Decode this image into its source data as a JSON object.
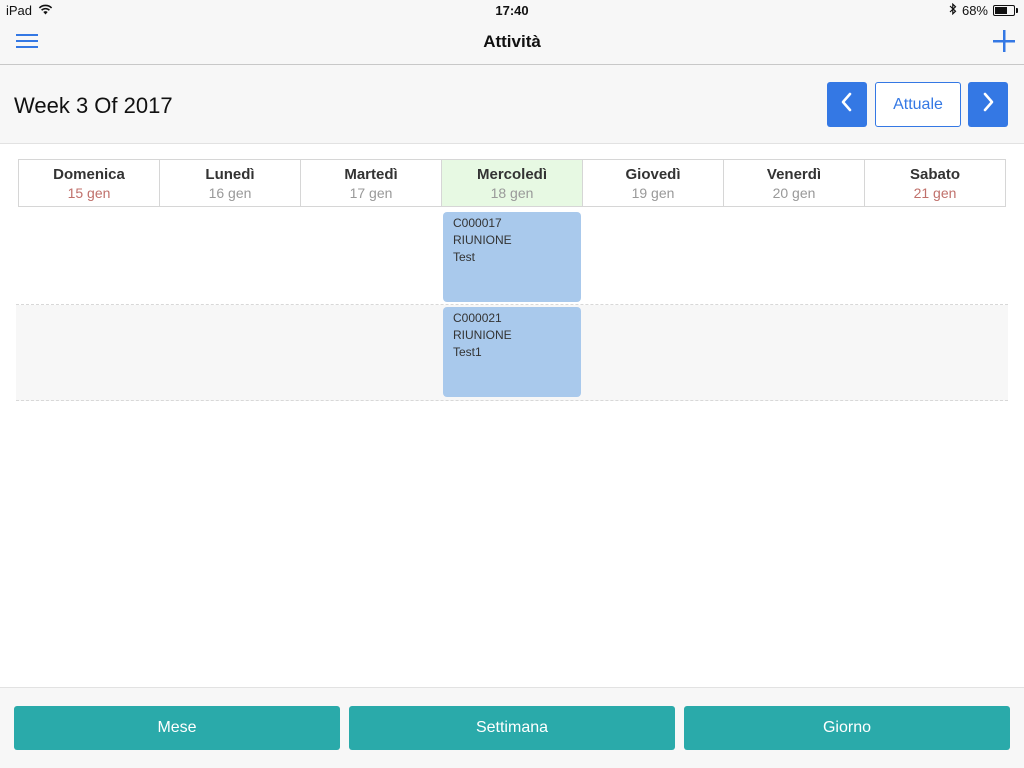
{
  "status_bar": {
    "device": "iPad",
    "time": "17:40",
    "battery": "68%",
    "battery_level": 0.68
  },
  "nav": {
    "title": "Attività",
    "menu_icon": "hamburger-menu-icon",
    "add_icon": "plus-icon"
  },
  "week": {
    "title": "Week 3 Of 2017",
    "today_label": "Attuale",
    "prev_icon": "chevron-left-icon",
    "next_icon": "chevron-right-icon"
  },
  "days": [
    {
      "name": "Domenica",
      "date": "15 gen",
      "weekend": true,
      "today": false
    },
    {
      "name": "Lunedì",
      "date": "16 gen",
      "weekend": false,
      "today": false
    },
    {
      "name": "Martedì",
      "date": "17 gen",
      "weekend": false,
      "today": false
    },
    {
      "name": "Mercoledì",
      "date": "18 gen",
      "weekend": false,
      "today": true
    },
    {
      "name": "Giovedì",
      "date": "19 gen",
      "weekend": false,
      "today": false
    },
    {
      "name": "Venerdì",
      "date": "20 gen",
      "weekend": false,
      "today": false
    },
    {
      "name": "Sabato",
      "date": "21 gen",
      "weekend": true,
      "today": false
    }
  ],
  "events": [
    {
      "code": "C000017",
      "type": "RIUNIONE",
      "title": "Test"
    },
    {
      "code": "C000021",
      "type": "RIUNIONE",
      "title": "Test1"
    }
  ],
  "bottom_tabs": {
    "month": "Mese",
    "week": "Settimana",
    "day": "Giorno"
  },
  "colors": {
    "accent": "#3478e4",
    "tab_button": "#2aaaaa",
    "event": "#a9c9ec",
    "today_column": "#e7f9e3",
    "weekend_date": "#c0706b"
  }
}
